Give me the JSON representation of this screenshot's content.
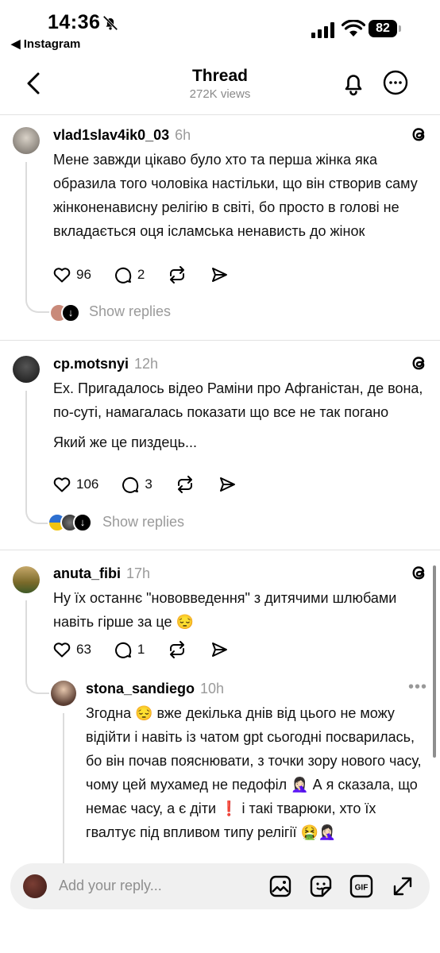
{
  "status_bar": {
    "time": "14:36",
    "back_app": "◀ Instagram",
    "battery": "82"
  },
  "header": {
    "title": "Thread",
    "subtitle": "272K views"
  },
  "posts": [
    {
      "username": "vlad1slav4ik0_03",
      "ago": "6h",
      "text": [
        "Мене завжди цікаво було хто та перша жінка яка образила того чоловіка настільки, що він створив саму жінконенависну релігію в світі, бо просто в голові не вкладається оця ісламська ненависть до жінок"
      ],
      "likes": "96",
      "comments": "2",
      "show_replies": "Show replies"
    },
    {
      "username": "cp.motsnyi",
      "ago": "12h",
      "text": [
        "Ех. Пригадалось відео Раміни про Афганістан, де вона, по-суті, намагалась показати що все не так погано",
        "Який же це пиздець..."
      ],
      "likes": "106",
      "comments": "3",
      "show_replies": "Show replies"
    },
    {
      "username": "anuta_fibi",
      "ago": "17h",
      "text": [
        "Ну їх останнє \"нововведення\" з дитячими шлюбами навіть гірше за це 😔"
      ],
      "likes": "63",
      "comments": "1"
    }
  ],
  "reply": {
    "username": "stona_sandiego",
    "ago": "10h",
    "text": "Згодна 😔 вже декілька днів від цього не можу відійти і навіть із чатом gpt сьогодні посварилась, бо він почав пояснювати, з точки зору нового часу, чому цей мухамед не педофіл 🤦🏻‍♀️ А я сказала, що немає часу, а є діти ❗ і такі тварюки, хто їх гвалтує під впливом типу релігії 🤮🤦🏻‍♀️"
  },
  "reply_bar": {
    "placeholder": "Add your reply..."
  },
  "icons": [
    "bell-slash-icon",
    "signal-icon",
    "wifi-icon",
    "battery-icon",
    "back-chevron-icon",
    "bell-icon",
    "more-icon",
    "threads-logo-icon",
    "heart-icon",
    "comment-icon",
    "repost-icon",
    "share-icon",
    "image-icon",
    "sticker-icon",
    "gif-icon",
    "expand-icon"
  ]
}
